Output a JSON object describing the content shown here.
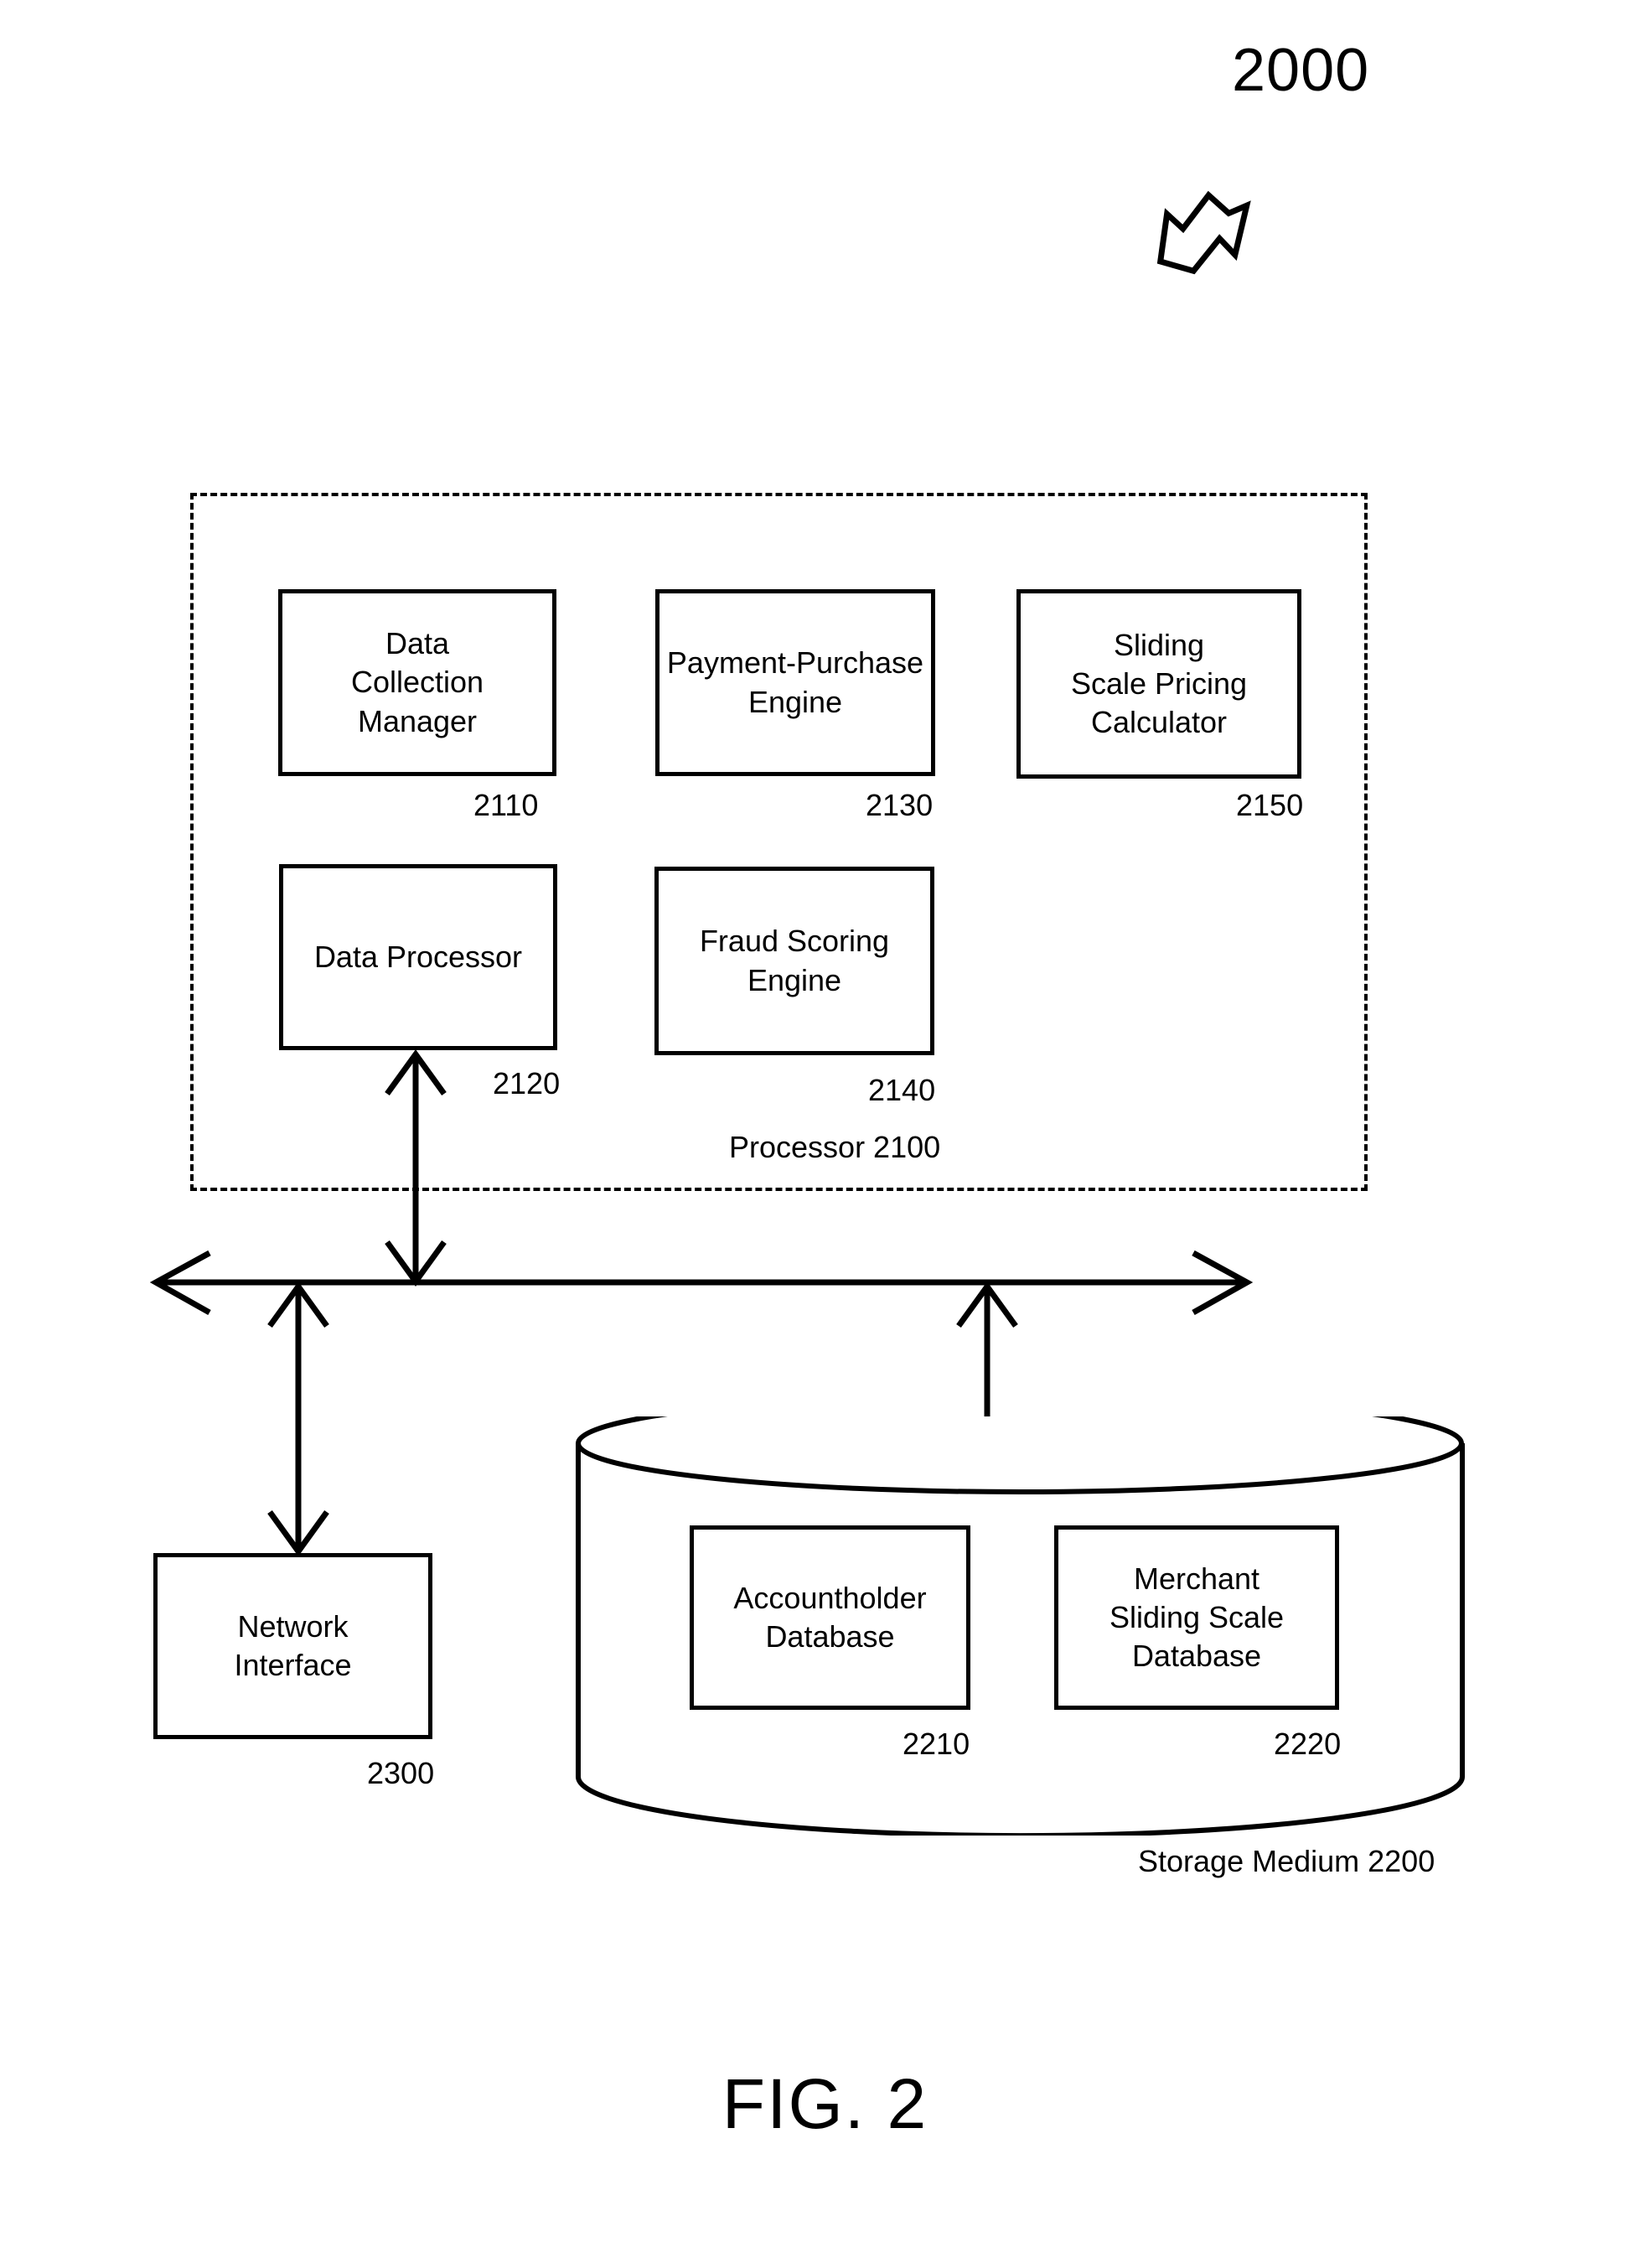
{
  "figure": {
    "system_number": "2000",
    "caption": "FIG. 2",
    "pointer_icon": "block-arrow-down-left-icon"
  },
  "processor": {
    "caption": "Processor 2100",
    "modules": [
      {
        "label": "Data\nCollection\nManager",
        "ref": "2110"
      },
      {
        "label": "Payment-Purchase\nEngine",
        "ref": "2130"
      },
      {
        "label": "Sliding\nScale Pricing\nCalculator",
        "ref": "2150"
      },
      {
        "label": "Data Processor",
        "ref": "2120"
      },
      {
        "label": "Fraud Scoring\nEngine",
        "ref": "2140"
      }
    ]
  },
  "bus": {
    "name": "system-bus",
    "left_arrow_icon": "arrow-left-icon",
    "right_arrow_icon": "arrow-right-icon"
  },
  "network_interface": {
    "label": "Network\nInterface",
    "ref": "2300"
  },
  "storage": {
    "caption": "Storage Medium 2200",
    "databases": [
      {
        "label": "Accountholder\nDatabase",
        "ref": "2210"
      },
      {
        "label": "Merchant\nSliding Scale\nDatabase",
        "ref": "2220"
      }
    ]
  },
  "colors": {
    "stroke": "#000000",
    "background": "#ffffff"
  }
}
